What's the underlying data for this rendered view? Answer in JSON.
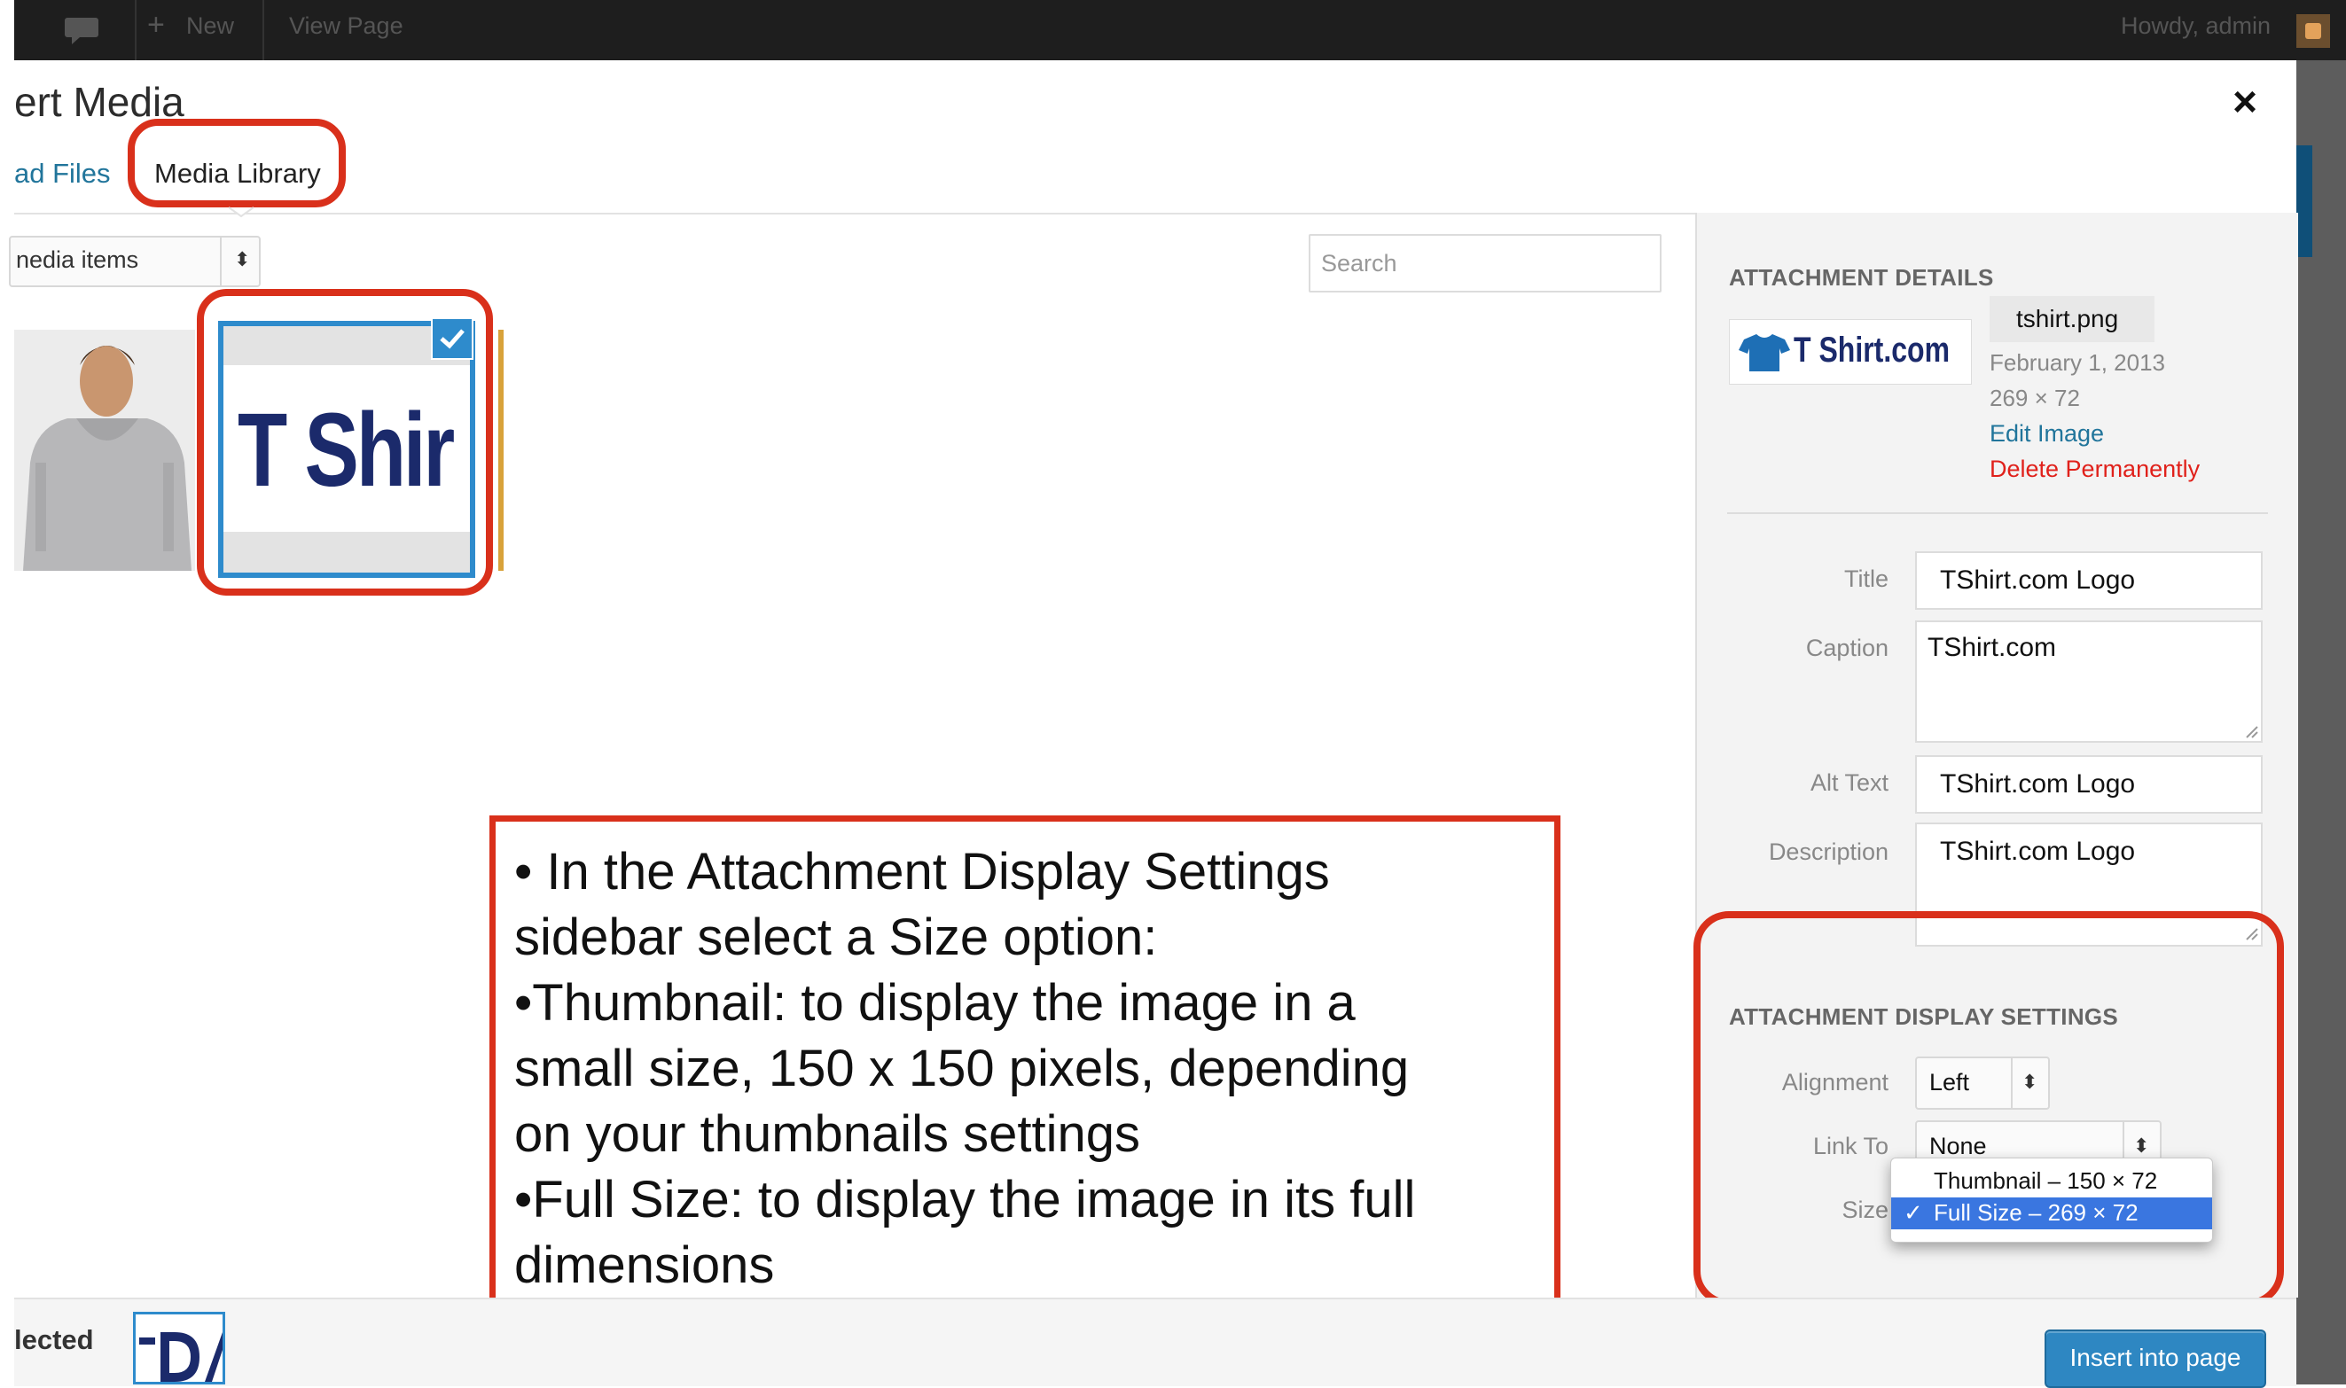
{
  "admin_bar": {
    "new_label": "New",
    "view_page_label": "View Page",
    "greeting": "Howdy, admin"
  },
  "modal": {
    "title": "ert Media",
    "tabs": {
      "upload": "ad Files",
      "library": "Media Library"
    },
    "filter": {
      "selected": "nedia items"
    },
    "search": {
      "placeholder": "Search"
    },
    "thumbnails": {
      "selected_text": "T Shir"
    },
    "instructions": [
      "• In the Attachment Display Settings",
      "sidebar select a Size option:",
      "•Thumbnail: to display the image in a",
      "small size, 150 x 150 pixels, depending",
      "on your thumbnails settings",
      "•Full Size: to display the image in its full",
      "dimensions"
    ],
    "footer": {
      "selected_label": "lected",
      "insert_button": "Insert into page"
    }
  },
  "attachment_details": {
    "header": "ATTACHMENT DETAILS",
    "logo_text": "T Shirt.com",
    "filename": "tshirt.png",
    "date": "February 1, 2013",
    "dimensions": "269 × 72",
    "edit_link": "Edit Image",
    "delete_link": "Delete Permanently",
    "fields": {
      "title": {
        "label": "Title",
        "value": "TShirt.com Logo"
      },
      "caption": {
        "label": "Caption",
        "value": "TShirt.com"
      },
      "alt_text": {
        "label": "Alt Text",
        "value": "TShirt.com Logo"
      },
      "description": {
        "label": "Description",
        "value": "TShirt.com Logo"
      }
    }
  },
  "display_settings": {
    "header": "ATTACHMENT DISPLAY SETTINGS",
    "alignment": {
      "label": "Alignment",
      "value": "Left"
    },
    "link_to": {
      "label": "Link To",
      "value": "None"
    },
    "size": {
      "label": "Size",
      "options": [
        "Thumbnail – 150 × 72",
        "Full Size – 269 × 72"
      ],
      "selected": "Full Size – 269 × 72",
      "check": "✓"
    }
  },
  "colors": {
    "annotation_red": "#d9301b",
    "wp_blue": "#21759b",
    "button_blue": "#2e87c2",
    "logo_navy": "#1b2a6b"
  }
}
